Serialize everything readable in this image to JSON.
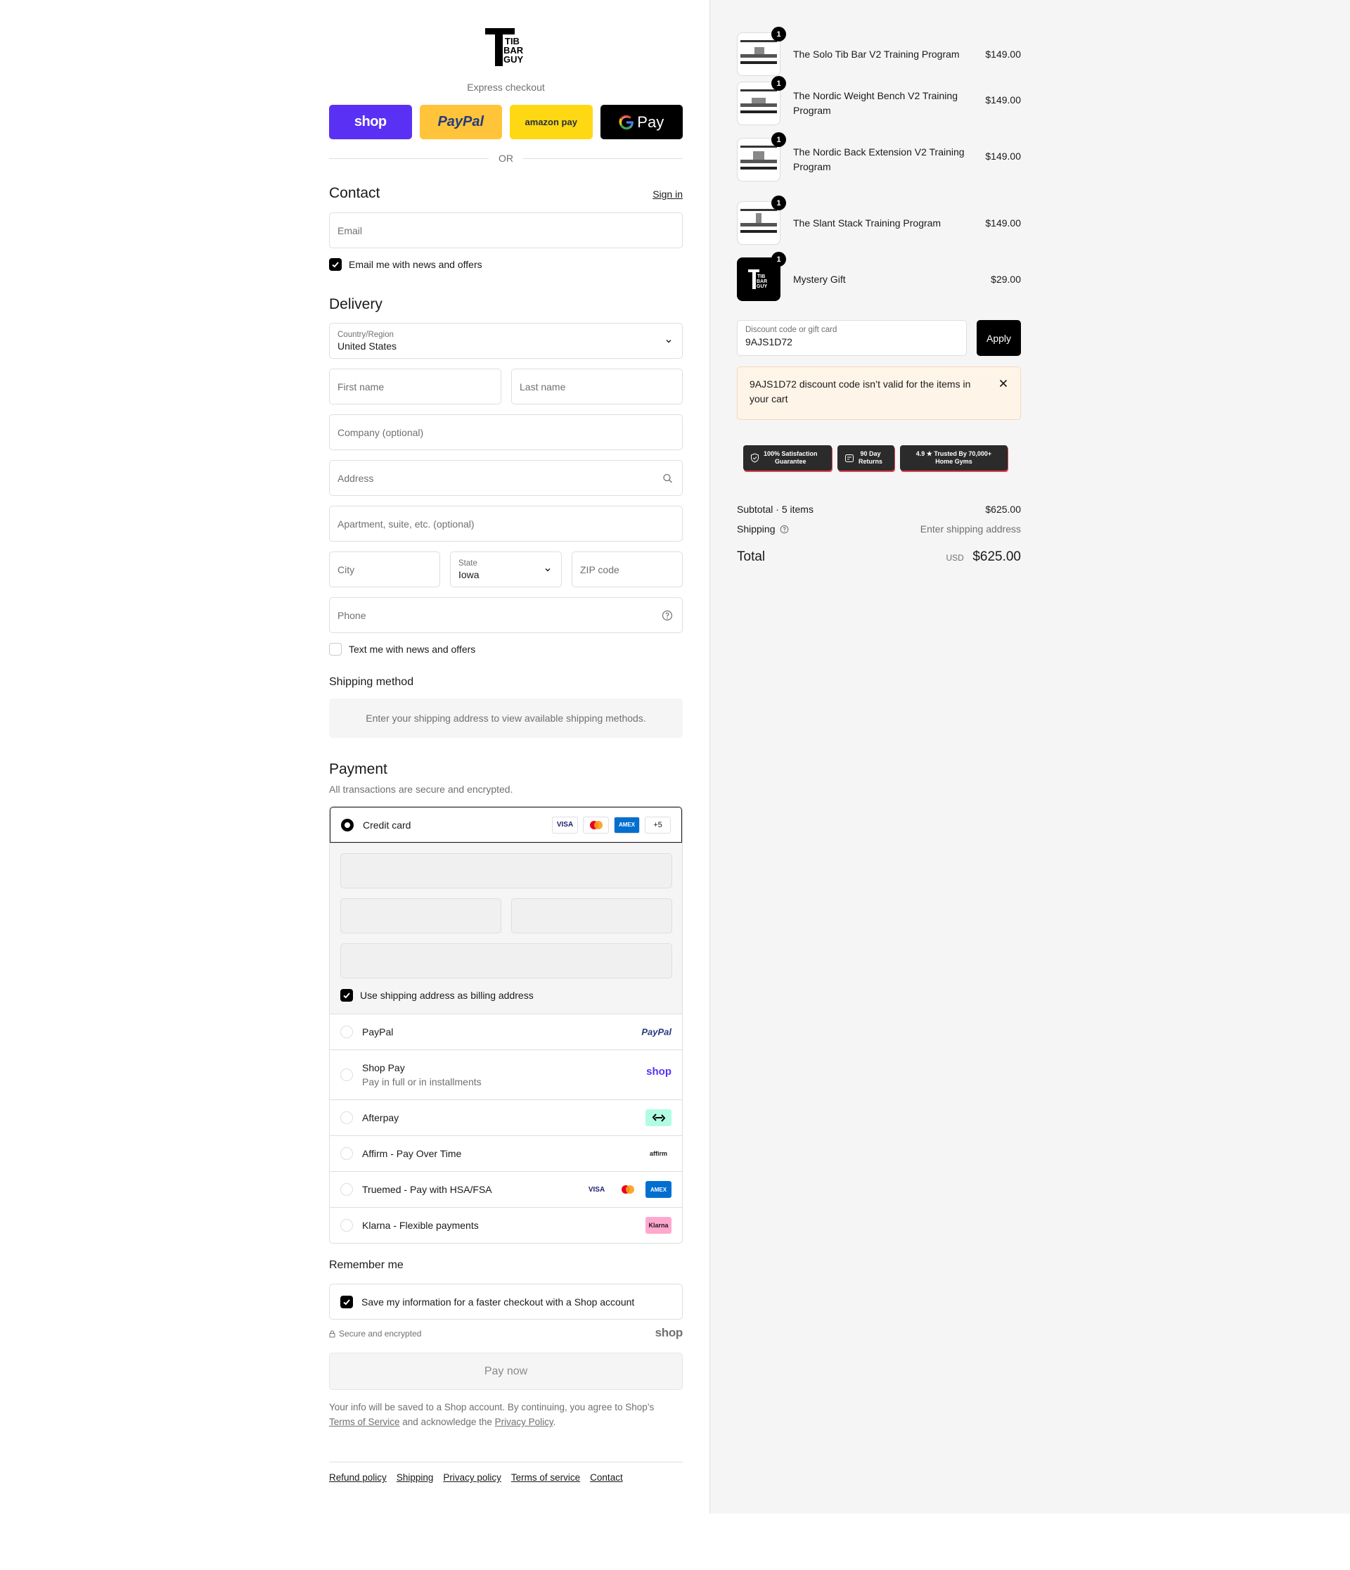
{
  "checkout": {
    "brand": {
      "logo_lines": [
        "TIB",
        "BAR",
        "GUY"
      ]
    },
    "express": {
      "label": "Express checkout",
      "buttons": [
        {
          "label": "shop",
          "icon": "shop-pay-logo"
        },
        {
          "label": "PayPal",
          "icon": "paypal-logo"
        },
        {
          "label": "amazon pay",
          "icon": "amazon-pay-logo"
        },
        {
          "label": "Pay",
          "icon": "google-g-logo"
        }
      ],
      "or": "OR"
    },
    "contact": {
      "title": "Contact",
      "sign_in": "Sign in",
      "email_placeholder": "Email",
      "email_news": "Email me with news and offers"
    },
    "delivery": {
      "title": "Delivery",
      "country_label": "Country/Region",
      "country_value": "United States",
      "first_name": "First name",
      "last_name": "Last name",
      "company": "Company (optional)",
      "address": "Address",
      "apartment": "Apartment, suite, etc. (optional)",
      "city": "City",
      "state_label": "State",
      "state_value": "Iowa",
      "zip": "ZIP code",
      "phone": "Phone",
      "text_news": "Text me with news and offers"
    },
    "shipping": {
      "title": "Shipping method",
      "message": "Enter your shipping address to view available shipping methods."
    },
    "payment": {
      "title": "Payment",
      "subtitle": "All transactions are secure and encrypted.",
      "credit_card": "Credit card",
      "card_more": "+5",
      "billing_same": "Use shipping address as billing address",
      "options": [
        {
          "label": "PayPal",
          "sub": ""
        },
        {
          "label": "Shop Pay",
          "sub": "Pay in full or in installments"
        },
        {
          "label": "Afterpay",
          "sub": ""
        },
        {
          "label": "Affirm - Pay Over Time",
          "sub": ""
        },
        {
          "label": "Truemed - Pay with HSA/FSA",
          "sub": ""
        },
        {
          "label": "Klarna - Flexible payments",
          "sub": ""
        }
      ],
      "logos": {
        "paypal": "PayPal",
        "shop": "shop",
        "affirm": "affirm",
        "klarna": "Klarna",
        "visa": "VISA",
        "amex": "AMEX"
      }
    },
    "remember": {
      "title": "Remember me",
      "save_label": "Save my information for a faster checkout with a Shop account",
      "secure": "Secure and encrypted",
      "shop": "shop"
    },
    "pay_now": "Pay now",
    "legal": {
      "text1": "Your info will be saved to a Shop account. By continuing, you agree to Shop’s",
      "tos": "Terms of Service",
      "text2": " and acknowledge the ",
      "privacy": "Privacy Policy",
      "text3": "."
    },
    "footer": [
      "Refund policy",
      "Shipping",
      "Privacy policy",
      "Terms of service",
      "Contact"
    ]
  },
  "summary": {
    "items": [
      {
        "name": "The Solo Tib Bar V2 Training Program",
        "price": "$149.00",
        "qty": "1"
      },
      {
        "name": "The Nordic Weight Bench V2 Training Program",
        "price": "$149.00",
        "qty": "1"
      },
      {
        "name": "The Nordic Back Extension V2 Training Program",
        "price": "$149.00",
        "qty": "1"
      },
      {
        "name": "The Slant Stack Training Program",
        "price": "$149.00",
        "qty": "1"
      },
      {
        "name": "Mystery Gift",
        "price": "$29.00",
        "qty": "1"
      }
    ],
    "discount": {
      "label": "Discount code or gift card",
      "value": "9AJS1D72",
      "apply": "Apply",
      "error": "9AJS1D72 discount code isn’t valid for the items in your cart"
    },
    "badges": [
      {
        "line1": "100% Satisfaction",
        "line2": "Guarantee"
      },
      {
        "line1": "90 Day",
        "line2": "Returns"
      },
      {
        "line1": "4.9 ★  Trusted By 70,000+",
        "line2": "Home Gyms"
      }
    ],
    "subtotal_label": "Subtotal · 5 items",
    "subtotal_value": "$625.00",
    "shipping_label": "Shipping",
    "shipping_value": "Enter shipping address",
    "total_label": "Total",
    "currency": "USD",
    "total_value": "$625.00"
  },
  "colors": {
    "shop": "#5a31f4",
    "paypal": "#ffc439",
    "amazon": "#ffd814",
    "error_bg": "#fff4e8"
  }
}
